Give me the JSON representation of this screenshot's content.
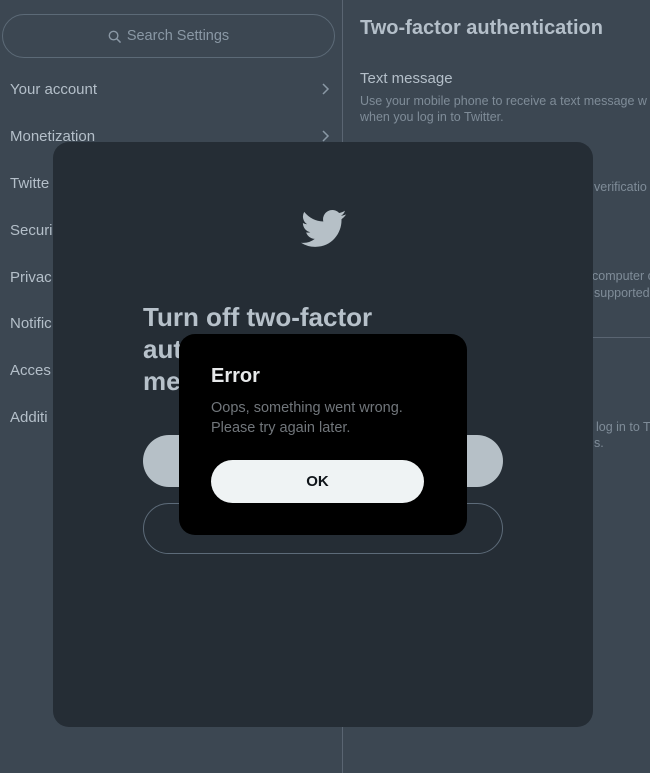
{
  "sidebar": {
    "search_placeholder": "Search Settings",
    "items": [
      {
        "label": "Your account"
      },
      {
        "label": "Monetization"
      },
      {
        "label": "Twitte"
      },
      {
        "label": "Securi"
      },
      {
        "label": "Privac"
      },
      {
        "label": "Notific"
      },
      {
        "label": "Acces"
      },
      {
        "label": "Additi"
      }
    ]
  },
  "content": {
    "title": "Two-factor authentication",
    "subtitle": "Text message",
    "description_line1": "Use your mobile phone to receive a text message w",
    "description_line2": "when you log in to Twitter.",
    "frag_verification": "verificatio",
    "frag_computer": "computer o",
    "frag_supported": "supported",
    "frag_login": "log in to T",
    "frag_s": "s."
  },
  "modal": {
    "heading_line1": "Turn off two-factor",
    "heading_line2": "aut",
    "heading_line3": "me"
  },
  "error_dialog": {
    "title": "Error",
    "message_line1": "Oops, something went wrong.",
    "message_line2": "Please try again later.",
    "ok_label": "OK"
  },
  "colors": {
    "page_bg": "#3c4752",
    "modal_bg": "#252d35",
    "dialog_bg": "#000000",
    "ok_button_bg": "#eff3f4"
  }
}
